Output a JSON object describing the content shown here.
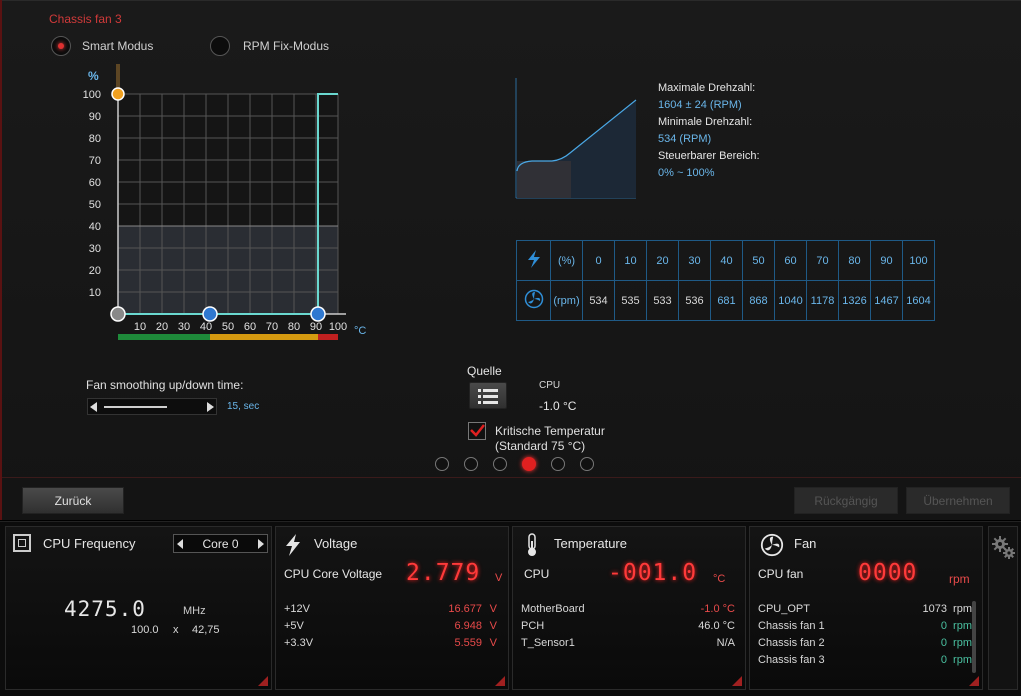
{
  "panel_title": "Chassis fan 3",
  "modes": [
    {
      "label": "Smart Modus",
      "selected": true
    },
    {
      "label": "RPM Fix-Modus",
      "selected": false
    }
  ],
  "graph": {
    "y_unit": "%",
    "y_ticks": [
      "100",
      "90",
      "80",
      "70",
      "60",
      "50",
      "40",
      "30",
      "20",
      "10"
    ],
    "x_ticks": [
      "10",
      "20",
      "30",
      "40",
      "50",
      "60",
      "70",
      "80",
      "90",
      "100"
    ],
    "x_unit": "°C"
  },
  "stats": {
    "max_label": "Maximale Drehzahl:",
    "max_value": "1604 ± 24 (RPM)",
    "min_label": "Minimale Drehzahl:",
    "min_value": "534 (RPM)",
    "range_label": "Steuerbarer Bereich:",
    "range_value": "0% ~ 100%"
  },
  "rpm_table": {
    "pct_unit": "(%)",
    "rpm_unit": "(rpm)",
    "percents": [
      "0",
      "10",
      "20",
      "30",
      "40",
      "50",
      "60",
      "70",
      "80",
      "90",
      "100"
    ],
    "rpms": [
      "534",
      "535",
      "533",
      "536",
      "681",
      "868",
      "1040",
      "1178",
      "1326",
      "1467",
      "1604"
    ]
  },
  "smoothing": {
    "label": "Fan smoothing up/down time:",
    "value": "15, sec"
  },
  "source": {
    "label": "Quelle",
    "sensor": "CPU",
    "temp": "-1.0 °C",
    "crit_line1": "Kritische Temperatur",
    "crit_line2": "(Standard 75 °C)"
  },
  "pager": {
    "count": 6,
    "active_index": 3
  },
  "buttons": {
    "back": "Zurück",
    "undo": "Rückgängig",
    "apply": "Übernehmen"
  },
  "cpu_freq": {
    "title": "CPU Frequency",
    "core_select": "Core 0",
    "value": "4275.0",
    "unit": "MHz",
    "bclk": "100.0",
    "x": "x",
    "ratio": "42,75"
  },
  "voltage": {
    "title": "Voltage",
    "main_label": "CPU Core Voltage",
    "main_value": "2.779",
    "main_unit": "V",
    "rows": [
      {
        "label": "+12V",
        "value": "16.677",
        "unit": "V"
      },
      {
        "label": "+5V",
        "value": "6.948",
        "unit": "V"
      },
      {
        "label": "+3.3V",
        "value": "5.559",
        "unit": "V"
      }
    ]
  },
  "temperature": {
    "title": "Temperature",
    "main_label": "CPU",
    "main_value": "-001.0",
    "main_unit": "°C",
    "rows": [
      {
        "label": "MotherBoard",
        "value": "-1.0 °C"
      },
      {
        "label": "PCH",
        "value": "46.0 °C"
      },
      {
        "label": "T_Sensor1",
        "value": "N/A"
      }
    ]
  },
  "fan": {
    "title": "Fan",
    "main_label": "CPU fan",
    "main_value": "0000",
    "main_unit": "rpm",
    "rows": [
      {
        "label": "CPU_OPT",
        "value": "1073",
        "unit": "rpm"
      },
      {
        "label": "Chassis fan 1",
        "value": "0",
        "unit": "rpm"
      },
      {
        "label": "Chassis fan 2",
        "value": "0",
        "unit": "rpm"
      },
      {
        "label": "Chassis fan 3",
        "value": "0",
        "unit": "rpm"
      }
    ]
  },
  "colors": {
    "accent_red": "#e03030",
    "accent_blue": "#6ab6ea",
    "curve": "#6ad8d0"
  }
}
